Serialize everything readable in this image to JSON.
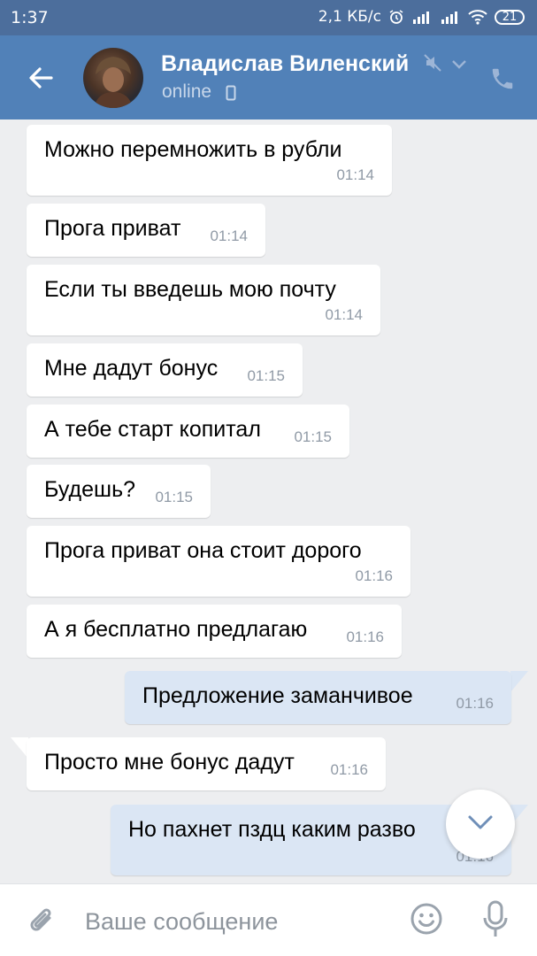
{
  "status_bar": {
    "time": "1:37",
    "speed": "2,1 КБ/с",
    "battery": "21"
  },
  "header": {
    "contact_name": "Владислав Виленский",
    "status": "online",
    "icons": [
      "back-arrow-icon",
      "mute-icon",
      "chevron-down-icon",
      "phone-icon"
    ]
  },
  "messages": [
    {
      "dir": "in",
      "text": "Можно перемножить в рубли",
      "time": "01:14"
    },
    {
      "dir": "in",
      "text": "Прога приват",
      "time": "01:14"
    },
    {
      "dir": "in",
      "text": "Если ты введешь мою почту",
      "time": "01:14"
    },
    {
      "dir": "in",
      "text": "Мне дадут бонус",
      "time": "01:15"
    },
    {
      "dir": "in",
      "text": "А тебе старт копитал",
      "time": "01:15"
    },
    {
      "dir": "in",
      "text": "Будешь?",
      "time": "01:15"
    },
    {
      "dir": "in",
      "text": "Прога приват она стоит дорого",
      "time": "01:16"
    },
    {
      "dir": "in",
      "text": "А я бесплатно предлагаю",
      "time": "01:16"
    },
    {
      "dir": "out",
      "text": "Предложение заманчивое",
      "time": "01:16"
    },
    {
      "dir": "in",
      "text": "Просто мне бонус дадут",
      "time": "01:16"
    },
    {
      "dir": "out",
      "text": "Но пахнет пздц каким разво",
      "time": "01:16"
    }
  ],
  "input": {
    "placeholder": "Ваше сообщение"
  },
  "colors": {
    "status_bar": "#4c6e9c",
    "header": "#5181b8",
    "background": "#edeef0",
    "incoming_bubble": "#ffffff",
    "outgoing_bubble": "#dbe6f4",
    "time_text": "#909aa6"
  }
}
